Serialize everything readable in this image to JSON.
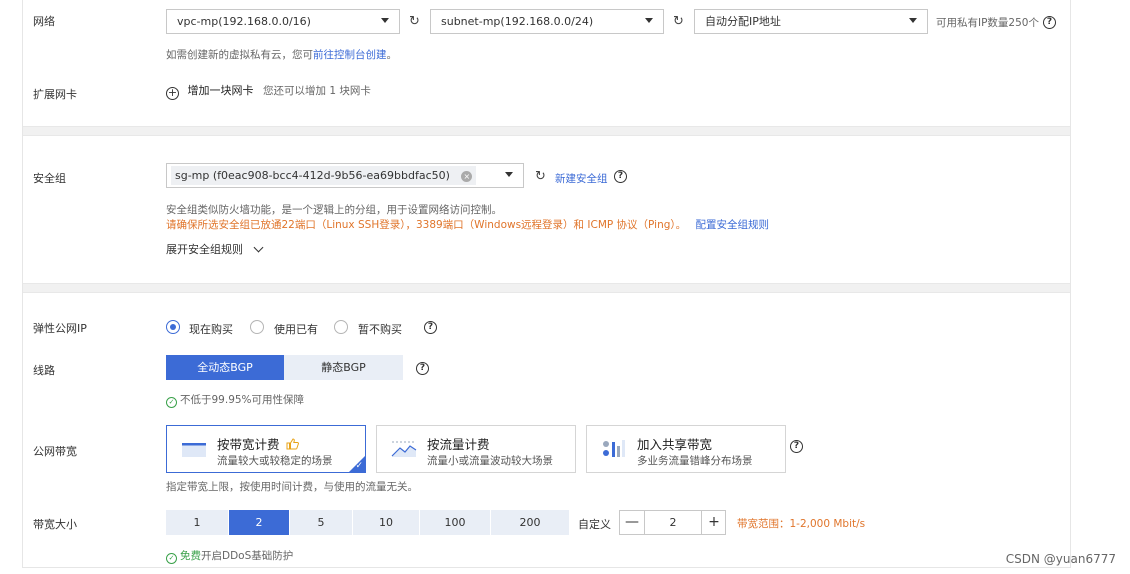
{
  "network": {
    "label": "网络",
    "vpc": "vpc-mp(192.168.0.0/16)",
    "subnet": "subnet-mp(192.168.0.0/24)",
    "ip_mode": "自动分配IP地址",
    "available_ip": "可用私有IP数量250个",
    "hint_prefix": "如需创建新的虚拟私有云，您可",
    "hint_link": "前往控制台创建",
    "hint_suffix": "。"
  },
  "extend_nic": {
    "label": "扩展网卡",
    "add_label": "增加一块网卡",
    "hint": "您还可以增加 1 块网卡"
  },
  "security_group": {
    "label": "安全组",
    "selected": "sg-mp (f0eac908-bcc4-412d-9b56-ea69bbdfac50)",
    "new_link": "新建安全组",
    "desc": "安全组类似防火墙功能，是一个逻辑上的分组，用于设置网络访问控制。",
    "warning": "请确保所选安全组已放通22端口（Linux SSH登录），3389端口（Windows远程登录）和 ICMP 协议（Ping）。",
    "config_link": "配置安全组规则",
    "expand_label": "展开安全组规则"
  },
  "eip": {
    "label": "弹性公网IP",
    "options": [
      "现在购买",
      "使用已有",
      "暂不购买"
    ],
    "selected_index": 0
  },
  "line": {
    "label": "线路",
    "options": [
      "全动态BGP",
      "静态BGP"
    ],
    "selected_index": 0,
    "guarantee": "不低于99.95%可用性保障"
  },
  "bandwidth_type": {
    "label": "公网带宽",
    "cards": [
      {
        "title": "按带宽计费",
        "subtitle": "流量较大或较稳定的场景",
        "icon": "bandwidth-icon",
        "thumb": "thumbs-up-icon"
      },
      {
        "title": "按流量计费",
        "subtitle": "流量小或流量波动较大场景",
        "icon": "traffic-icon"
      },
      {
        "title": "加入共享带宽",
        "subtitle": "多业务流量错峰分布场景",
        "icon": "shared-bandwidth-icon"
      }
    ],
    "selected_index": 0,
    "note": "指定带宽上限，按使用时间计费，与使用的流量无关。"
  },
  "bandwidth_size": {
    "label": "带宽大小",
    "options": [
      "1",
      "2",
      "5",
      "10",
      "100",
      "200"
    ],
    "selected_index": 1,
    "custom_label": "自定义",
    "minus": "—",
    "plus": "+",
    "value": "2",
    "range": "带宽范围：1-2,000 Mbit/s",
    "ddos_link": "免费",
    "ddos_text": "开启DDoS基础防护"
  },
  "colors": {
    "accent": "#3c6bd6",
    "warning": "#e0752b",
    "success": "#3aa14a"
  },
  "watermark": "CSDN @yuan6777"
}
